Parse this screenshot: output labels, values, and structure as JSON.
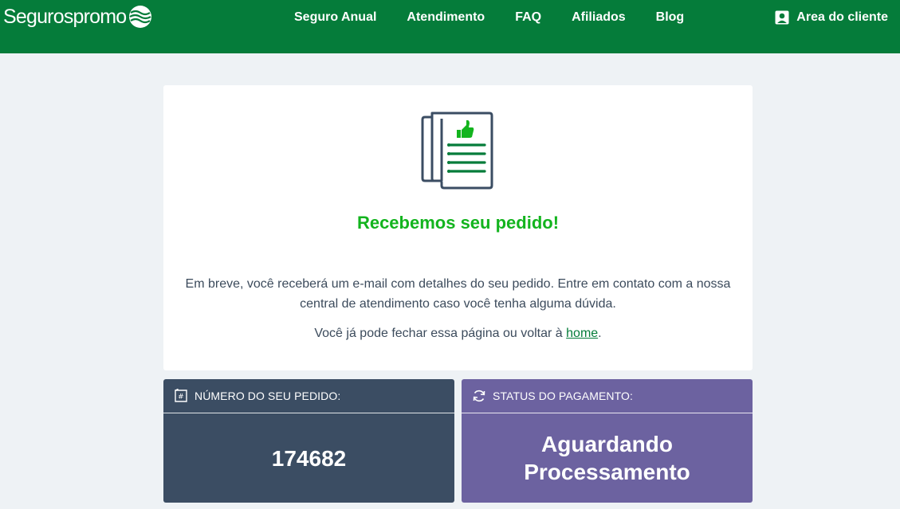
{
  "header": {
    "logo_text": "Segurospromo",
    "nav": [
      {
        "label": "Seguro Anual"
      },
      {
        "label": "Atendimento"
      },
      {
        "label": "FAQ"
      },
      {
        "label": "Afiliados"
      },
      {
        "label": "Blog"
      }
    ],
    "client_area": {
      "label": "Area do cliente",
      "icon": "user-icon"
    },
    "brand_color": "#057c3a"
  },
  "confirmation": {
    "icon": "document-thumbs-up-icon",
    "title": "Recebemos seu pedido!",
    "message": "Em breve, você receberá um e-mail com detalhes do seu pedido. Entre em contato com a nossa central de atendimento caso você tenha alguma dúvida.",
    "close_text": "Você já pode fechar essa página ou voltar à ",
    "home_link": "home",
    "close_suffix": ".",
    "title_color": "#13b41e"
  },
  "order": {
    "label": "NÚMERO DO SEU PEDIDO:",
    "icon": "receipt-icon",
    "number": "174682",
    "color": "#3b4d63"
  },
  "payment": {
    "label": "STATUS DO PAGAMENTO:",
    "icon": "refresh-icon",
    "status_line1": "Aguardando",
    "status_line2": "Processamento",
    "color": "#6c62a0"
  }
}
